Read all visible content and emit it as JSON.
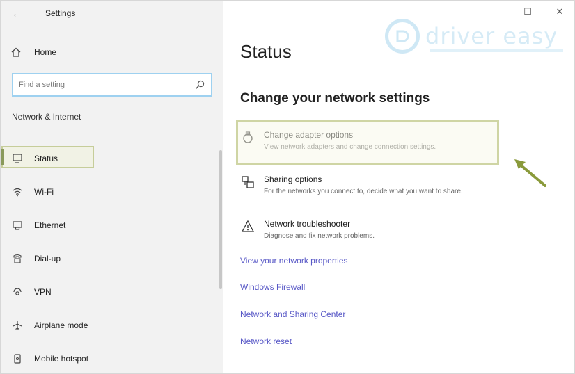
{
  "app": {
    "title": "Settings",
    "back_glyph": "←",
    "win_minimize": "—",
    "win_maximize": "☐",
    "win_close": "✕"
  },
  "nav": {
    "home_label": "Home",
    "search_placeholder": "Find a setting",
    "section_header": "Network & Internet",
    "items": [
      {
        "label": "Status",
        "icon": "status-icon"
      },
      {
        "label": "Wi-Fi",
        "icon": "wifi-icon"
      },
      {
        "label": "Ethernet",
        "icon": "ethernet-icon"
      },
      {
        "label": "Dial-up",
        "icon": "dialup-icon"
      },
      {
        "label": "VPN",
        "icon": "vpn-icon"
      },
      {
        "label": "Airplane mode",
        "icon": "airplane-icon"
      },
      {
        "label": "Mobile hotspot",
        "icon": "hotspot-icon"
      }
    ]
  },
  "main": {
    "title": "Status",
    "subtitle": "Change your network settings",
    "options": [
      {
        "title": "Change adapter options",
        "desc": "View network adapters and change connection settings.",
        "icon": "adapter-icon"
      },
      {
        "title": "Sharing options",
        "desc": "For the networks you connect to, decide what you want to share.",
        "icon": "sharing-icon"
      },
      {
        "title": "Network troubleshooter",
        "desc": "Diagnose and fix network problems.",
        "icon": "troubleshooter-icon"
      }
    ],
    "links": [
      "View your network properties",
      "Windows Firewall",
      "Network and Sharing Center",
      "Network reset"
    ]
  },
  "watermark": {
    "text": "driver easy"
  },
  "colors": {
    "accent_link": "#5757c6",
    "highlight_border": "#cfd5a4",
    "arrow": "#8a9a3b",
    "nav_bg": "#f2f2f2"
  }
}
